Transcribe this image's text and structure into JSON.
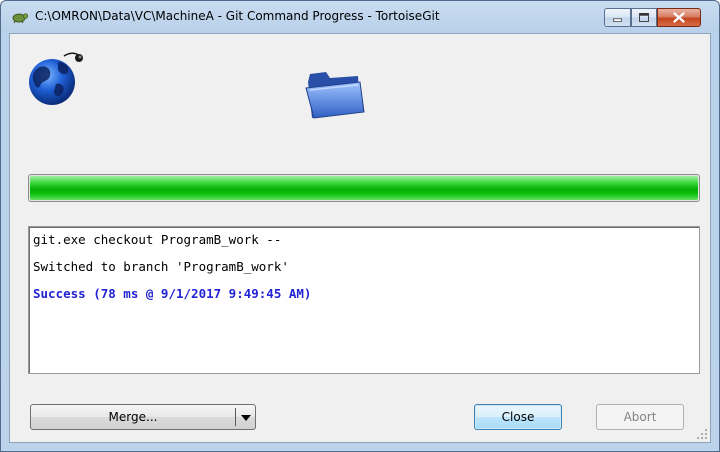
{
  "window": {
    "title": "C:\\OMRON\\Data\\VC\\MachineA - Git Command Progress - TortoiseGit"
  },
  "progress": {
    "fraction": 1.0,
    "color": "#0fc20f"
  },
  "log": {
    "lines": [
      {
        "text": "git.exe checkout ProgramB_work --",
        "kind": "normal"
      },
      {
        "text": "Switched to branch 'ProgramB_work'",
        "kind": "normal"
      },
      {
        "text": "Success (78 ms @ 9/1/2017 9:49:45 AM)",
        "kind": "success"
      }
    ]
  },
  "buttons": {
    "merge": "Merge...",
    "close": "Close",
    "abort": "Abort"
  }
}
